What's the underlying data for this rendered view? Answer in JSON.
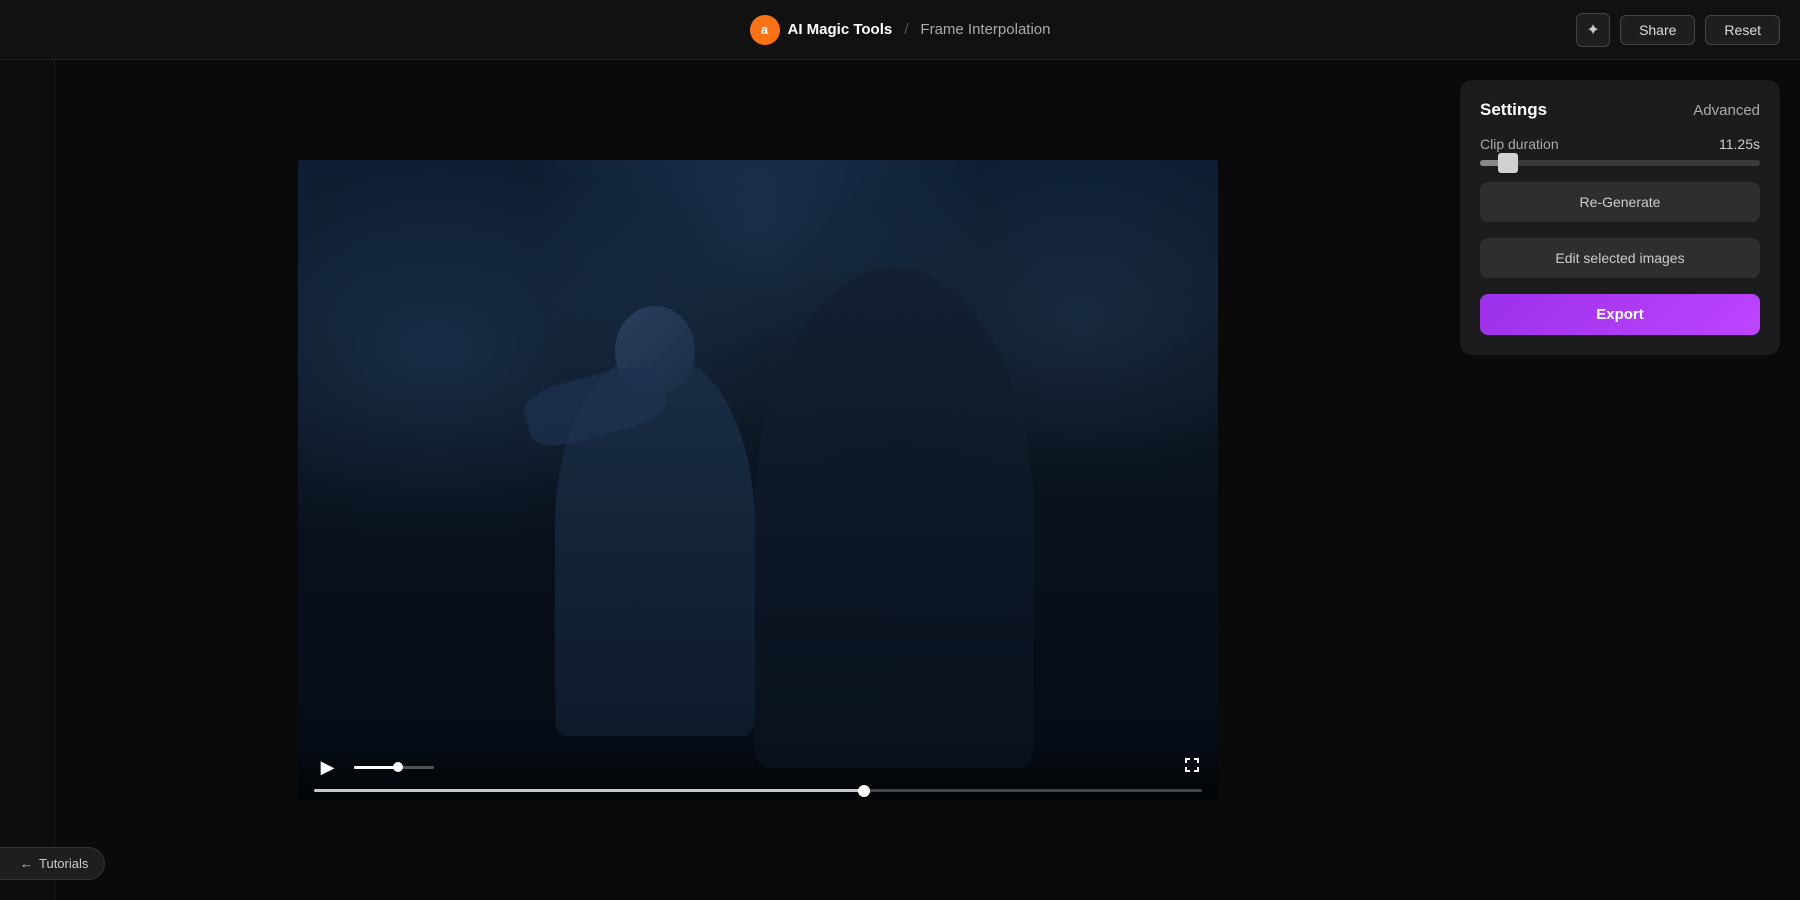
{
  "topbar": {
    "logo_initial": "a",
    "app_name": "AI Magic Tools",
    "separator": "/",
    "page_title": "Frame Interpolation",
    "share_label": "Share",
    "reset_label": "Reset",
    "magic_icon": "✦"
  },
  "video": {
    "play_icon": "▶",
    "fullscreen_icon": "⛶",
    "seek_position_pct": 62,
    "volume_pct": 55
  },
  "settings": {
    "title": "Settings",
    "advanced_label": "Advanced",
    "clip_duration_label": "Clip duration",
    "clip_duration_value": "11.25s",
    "regenerate_label": "Re-Generate",
    "edit_images_label": "Edit selected images",
    "export_label": "Export"
  },
  "tutorials": {
    "label": "Tutorials"
  }
}
